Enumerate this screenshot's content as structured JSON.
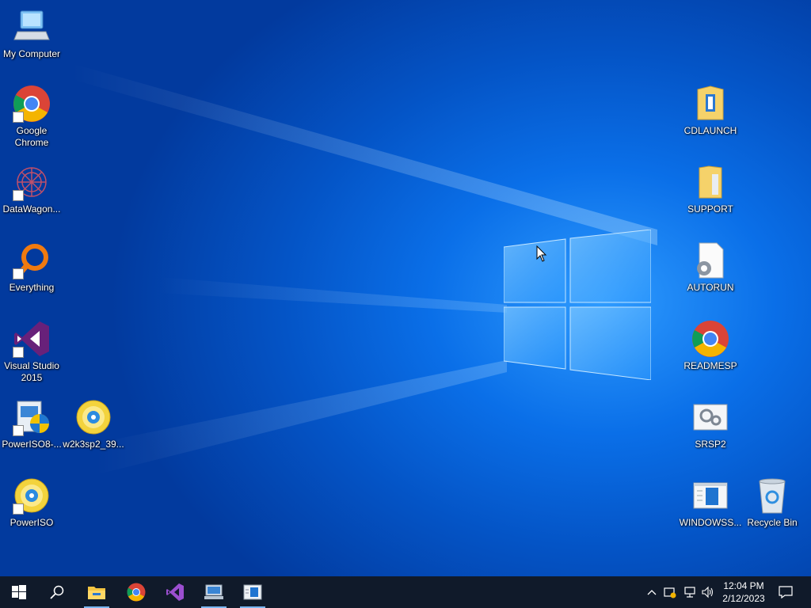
{
  "desktop": {
    "icons_left": [
      {
        "name": "my-computer",
        "label1": "My Computer",
        "label2": ""
      },
      {
        "name": "google-chrome",
        "label1": "Google",
        "label2": "Chrome"
      },
      {
        "name": "datawagon",
        "label1": "DataWagon...",
        "label2": ""
      },
      {
        "name": "everything",
        "label1": "Everything",
        "label2": ""
      },
      {
        "name": "visual-studio-2015",
        "label1": "Visual Studio",
        "label2": "2015"
      },
      {
        "name": "poweriso8",
        "label1": "PowerISO8-...",
        "label2": ""
      },
      {
        "name": "w2k3sp2",
        "label1": "w2k3sp2_39...",
        "label2": ""
      },
      {
        "name": "poweriso",
        "label1": "PowerISO",
        "label2": ""
      }
    ],
    "icons_right": [
      {
        "name": "cdlaunch",
        "label1": "CDLAUNCH"
      },
      {
        "name": "support",
        "label1": "SUPPORT"
      },
      {
        "name": "autorun",
        "label1": "AUTORUN"
      },
      {
        "name": "readmesp",
        "label1": "READMESP"
      },
      {
        "name": "srsp2",
        "label1": "SRSP2"
      },
      {
        "name": "windowss",
        "label1": "WINDOWSS..."
      },
      {
        "name": "recycle-bin",
        "label1": "Recycle Bin"
      }
    ]
  },
  "taskbar": {
    "pinned": [
      "start-icon",
      "search-icon",
      "file-explorer-icon",
      "chrome-icon",
      "visual-studio-icon",
      "network-app-icon",
      "setup-app-icon"
    ],
    "tray_icons": [
      "chevron-up-icon",
      "security-icon",
      "network-icon",
      "volume-icon",
      "notification-icon"
    ],
    "clock": {
      "time": "12:04 PM",
      "date": "2/12/2023"
    }
  },
  "colors": {
    "taskbar": "#101a2a",
    "desktop": "#0a6fe8",
    "accent": "#7ab6f0"
  }
}
